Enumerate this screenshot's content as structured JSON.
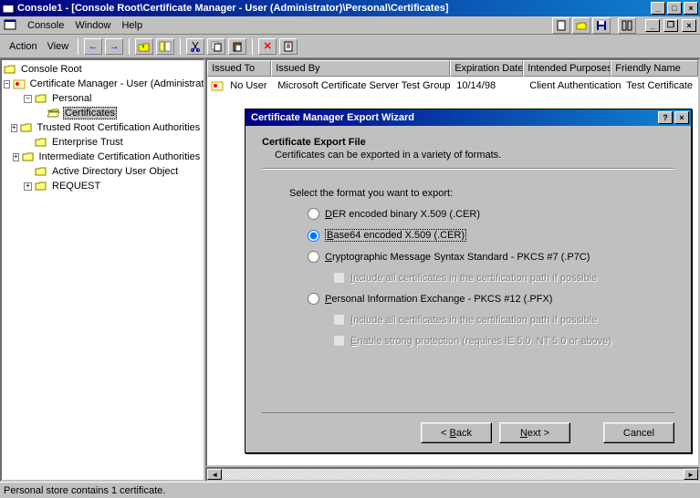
{
  "window": {
    "title": "Console1 - [Console Root\\Certificate Manager - User (Administrator)\\Personal\\Certificates]"
  },
  "menubar": {
    "console": "Console",
    "window": "Window",
    "help": "Help"
  },
  "toolbar": {
    "action": "Action",
    "view": "View"
  },
  "tree": {
    "root": "Console Root",
    "cert_mgr": "Certificate Manager - User (Administrator)",
    "personal": "Personal",
    "certificates": "Certificates",
    "trusted_root": "Trusted Root Certification Authorities",
    "enterprise_trust": "Enterprise Trust",
    "intermediate": "Intermediate Certification Authorities",
    "ad_user": "Active Directory User Object",
    "request": "REQUEST"
  },
  "list": {
    "headers": {
      "issued_to": "Issued To",
      "issued_by": "Issued By",
      "expiration": "Expiration Date",
      "purposes": "Intended Purposes",
      "friendly": "Friendly Name"
    },
    "rows": [
      {
        "issued_to": "No User",
        "issued_by": "Microsoft Certificate Server Test Group",
        "expiration": "10/14/98",
        "purposes": "Client Authentication",
        "friendly": "Test Certificate"
      }
    ]
  },
  "dialog": {
    "title": "Certificate Manager Export Wizard",
    "heading": "Certificate Export File",
    "sub": "Certificates can be exported in a variety of formats.",
    "prompt": "Select the format you want to export:",
    "opt_der": "DER encoded binary X.509 (.CER)",
    "opt_base64": "Base64 encoded X.509 (.CER)",
    "opt_pkcs7": "Cryptographic Message Syntax Standard - PKCS #7 (.P7C)",
    "chk_include1": "Include all certificates in the certification path if possible",
    "opt_pfx": "Personal Information Exchange - PKCS #12 (.PFX)",
    "chk_include2": "Include all certificates in the certification path if possible",
    "chk_strong": "Enable strong protection (requires IE 5.0, NT 5.0 or above)",
    "back": "< Back",
    "next": "Next >",
    "cancel": "Cancel"
  },
  "status": "Personal store contains 1 certificate."
}
